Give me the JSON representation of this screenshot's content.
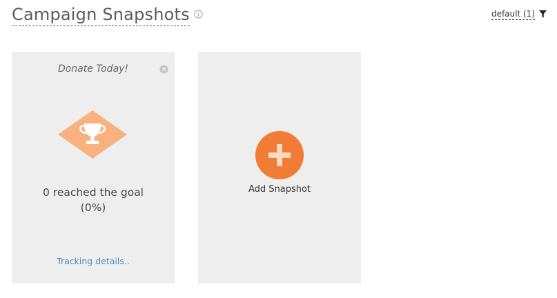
{
  "header": {
    "title": "Campaign Snapshots",
    "info_icon": "info-icon",
    "filter_label": "default (1)",
    "filter_icon": "filter-icon"
  },
  "cards": [
    {
      "title": "Donate Today!",
      "close_icon": "close-icon",
      "badge_icon": "trophy-icon",
      "goal_line1": "0 reached the goal",
      "goal_line2": "(0%)",
      "link": "Tracking details.."
    }
  ],
  "add_card": {
    "icon": "plus-icon",
    "label": "Add Snapshot"
  },
  "colors": {
    "card_bg": "#eeeeee",
    "accent_orange": "#f07c36",
    "badge_orange": "#f9b27f",
    "link_blue": "#4a8ac4"
  }
}
